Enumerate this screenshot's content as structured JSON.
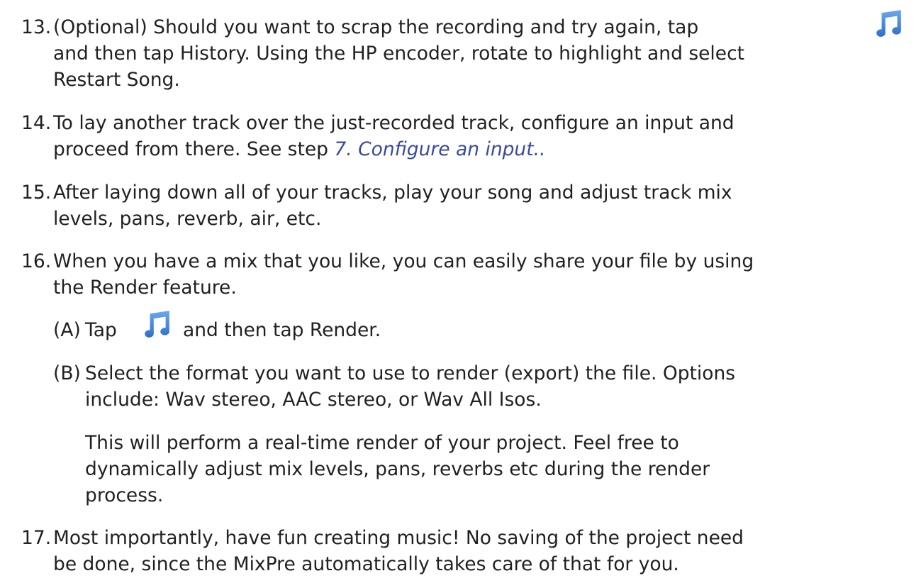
{
  "items": [
    {
      "number": "13.",
      "lines": [
        "(Optional) Should you want to scrap the recording and try again, tap",
        "and then tap History. Using the HP encoder, rotate to highlight and select",
        "Restart Song."
      ]
    },
    {
      "number": "14.",
      "lines": [
        "To lay another track over the just-recorded track, configure an input and",
        "proceed from there. See step "
      ],
      "link": "7. Configure an input.."
    },
    {
      "number": "15.",
      "lines": [
        "After laying down all of your tracks, play your song and adjust track mix",
        "levels, pans, reverb, air, etc."
      ]
    },
    {
      "number": "16.",
      "lines": [
        "When you have a mix that you like, you can easily share your file by using",
        "the Render feature."
      ],
      "subitems": [
        {
          "label": "(A)",
          "before_icon": "Tap",
          "after_icon": "and then tap Render."
        },
        {
          "label": "(B)",
          "lines": [
            "Select the format you want to use to render (export) the file. Options",
            "include: Wav stereo, AAC stereo, or Wav All Isos."
          ]
        }
      ],
      "note_lines": [
        "This will perform a real-time render of your project. Feel free to",
        "dynamically adjust mix levels, pans, reverbs etc during the render",
        "process."
      ]
    },
    {
      "number": "17.",
      "lines": [
        "Most importantly, have fun creating music!  No saving of the project need",
        "be done, since the MixPre automatically takes care of that for you."
      ]
    }
  ],
  "icon": {
    "name": "music-note-icon",
    "color": "#3d7fd6"
  }
}
